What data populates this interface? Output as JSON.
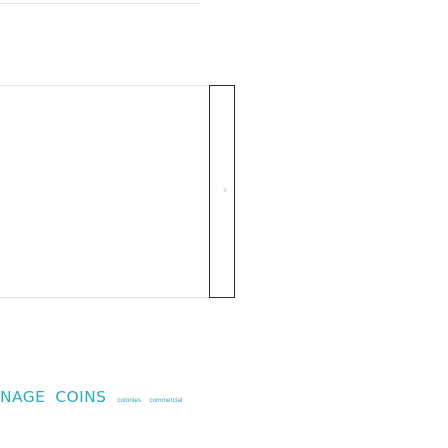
{
  "brand": {
    "word_1": "INAGE",
    "word_2": "COINS"
  },
  "tags": [
    "colonies",
    "commercial"
  ],
  "carousel": {
    "next_arrow": "›"
  },
  "colors": {
    "brand_teal": "#2fa8b9",
    "frame_border": "#2b2b2b",
    "arrow_grey": "#c7c9cf",
    "divider": "#e3e6ee"
  }
}
